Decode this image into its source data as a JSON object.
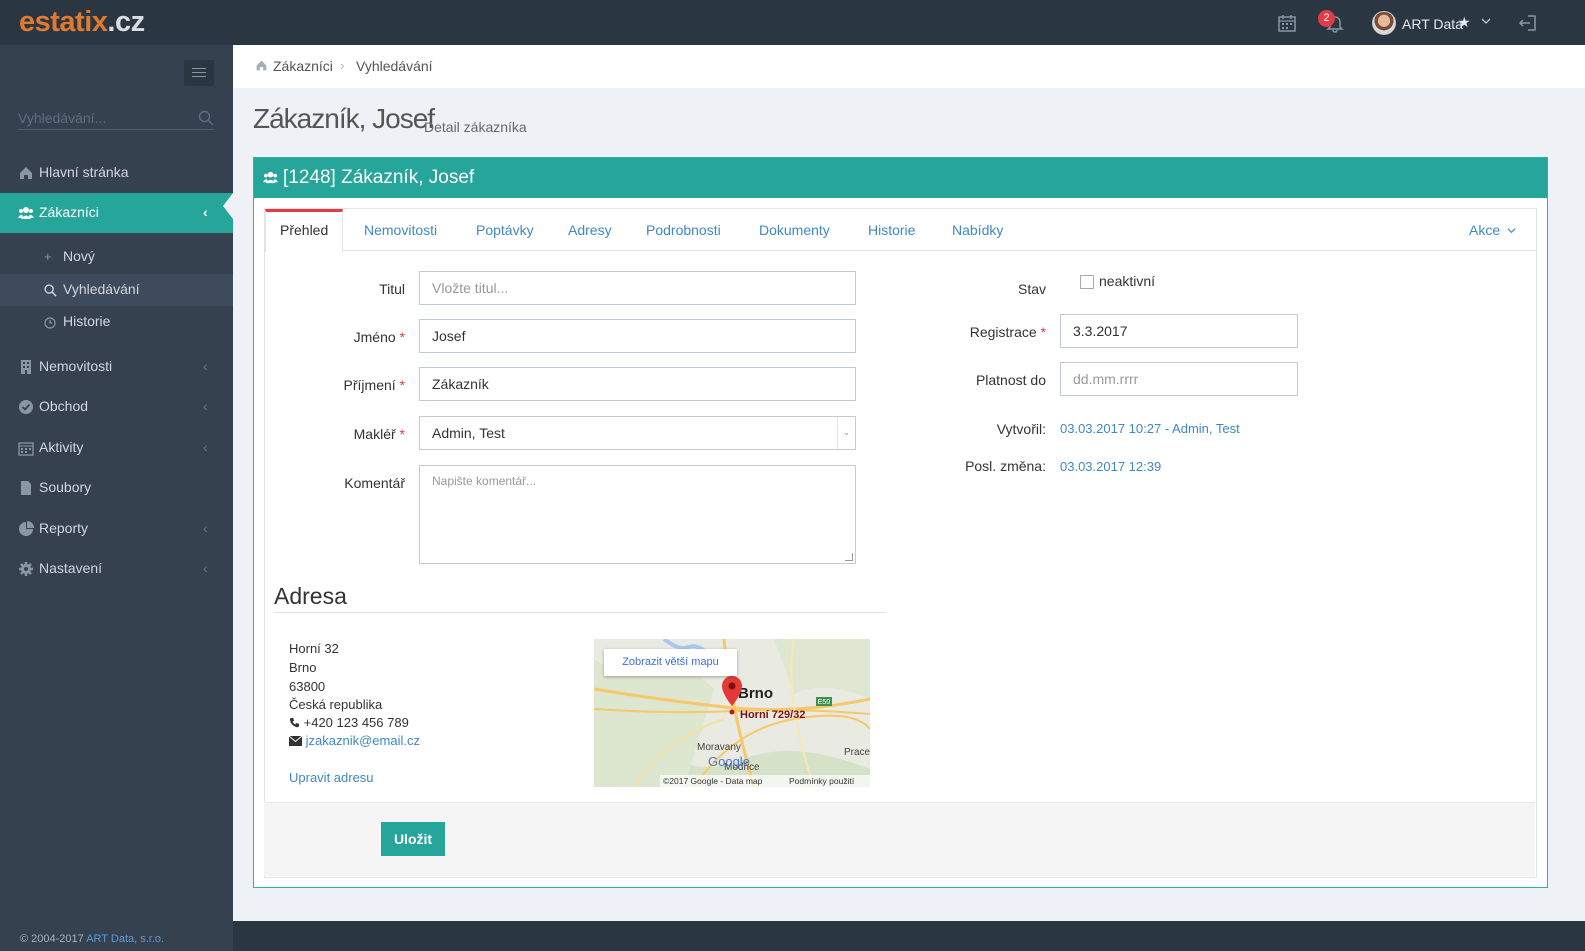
{
  "brand": {
    "name": "estatix",
    "tld": ".cz"
  },
  "topbar": {
    "notifications_count": "2",
    "user_name": "ART Data",
    "star": "★",
    "chevron": "⌄"
  },
  "sidebar": {
    "search_placeholder": "Vyhledávání...",
    "items": [
      {
        "label": "Hlavní stránka",
        "icon": "home-icon"
      },
      {
        "label": "Zákazníci",
        "icon": "users-icon",
        "active": true
      },
      {
        "label": "Nemovitosti",
        "icon": "building-icon"
      },
      {
        "label": "Obchod",
        "icon": "check-circle-icon"
      },
      {
        "label": "Aktivity",
        "icon": "calendar-icon"
      },
      {
        "label": "Soubory",
        "icon": "file-icon"
      },
      {
        "label": "Reporty",
        "icon": "pie-chart-icon"
      },
      {
        "label": "Nastavení",
        "icon": "gear-icon"
      }
    ],
    "subitems": [
      {
        "label": "Nový",
        "icon": "plus-icon"
      },
      {
        "label": "Vyhledávání",
        "icon": "search-icon",
        "active": true
      },
      {
        "label": "Historie",
        "icon": "clock-icon"
      }
    ],
    "footer_text": "© 2004-2017",
    "footer_link": "ART Data, s.r.o."
  },
  "breadcrumb": {
    "items": [
      "Zákazníci",
      "Vyhledávání"
    ],
    "separator": "›"
  },
  "page": {
    "title": "Zákazník, Josef",
    "subtitle": "Detail zákazníka"
  },
  "portlet": {
    "title": "[1248] Zákazník, Josef"
  },
  "tabs": [
    "Přehled",
    "Nemovitosti",
    "Poptávky",
    "Adresy",
    "Podrobnosti",
    "Dokumenty",
    "Historie",
    "Nabídky"
  ],
  "actions_label": "Akce",
  "form": {
    "titul": {
      "label": "Titul",
      "placeholder": "Vložte titul..."
    },
    "jmeno": {
      "label": "Jméno",
      "value": "Josef"
    },
    "prijmeni": {
      "label": "Příjmení",
      "value": "Zákazník"
    },
    "makler": {
      "label": "Makléř",
      "value": "Admin, Test"
    },
    "komentar": {
      "label": "Komentář",
      "placeholder": "Napište komentář..."
    },
    "stav": {
      "label": "Stav",
      "checkbox_label": "neaktivní"
    },
    "registrace": {
      "label": "Registrace",
      "value": "3.3.2017"
    },
    "platnost": {
      "label": "Platnost do",
      "placeholder": "dd.mm.rrrr"
    },
    "vytvoril": {
      "label": "Vytvořil:",
      "value": "03.03.2017 10:27 - Admin, Test"
    },
    "posl_zmena": {
      "label": "Posl. změna:",
      "value": "03.03.2017 12:39"
    },
    "required_mark": "*"
  },
  "address": {
    "title": "Adresa",
    "street": "Horní 32",
    "city": "Brno",
    "zip": "63800",
    "country": "Česká republika",
    "phone": "+420 123 456 789",
    "email": "jzakaznik@email.cz",
    "edit_link": "Upravit adresu"
  },
  "map": {
    "button": "Zobrazit větší mapu",
    "marker_label": "Horní 729/32",
    "city_label": "Brno",
    "place1": "Moravany",
    "place2": "Modřice",
    "place3": "Prace",
    "road": "E50",
    "copyright": "©2017 Google - Data map",
    "terms": "Podmínky použití",
    "google": "Google"
  },
  "save_button": "Uložit"
}
